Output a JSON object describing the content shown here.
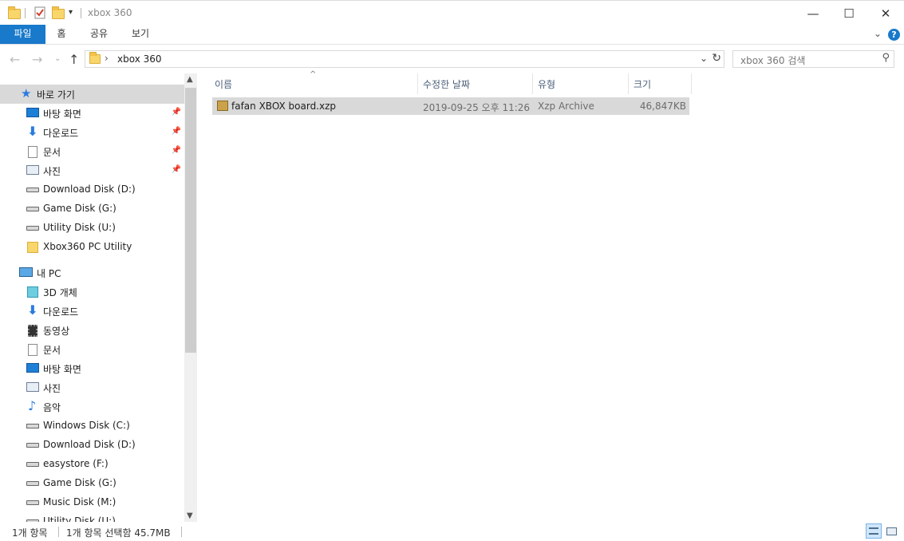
{
  "window": {
    "title": "xbox 360",
    "minimize": "—",
    "maximize": "☐",
    "close": "✕"
  },
  "ribbon": {
    "tabs": [
      "파일",
      "홈",
      "공유",
      "보기"
    ],
    "collapse_icon": "chevron-down-icon",
    "help": "?"
  },
  "address": {
    "path": "xbox 360",
    "separator": "›"
  },
  "search": {
    "placeholder": "xbox 360 검색"
  },
  "sidebar": {
    "quick_access": "바로 가기",
    "quick_items": [
      {
        "label": "바탕 화면",
        "icon": "desktop-icon",
        "pinned": true
      },
      {
        "label": "다운로드",
        "icon": "download-icon",
        "pinned": true
      },
      {
        "label": "문서",
        "icon": "document-icon",
        "pinned": true
      },
      {
        "label": "사진",
        "icon": "picture-icon",
        "pinned": true
      },
      {
        "label": "Download Disk (D:)",
        "icon": "drive-icon"
      },
      {
        "label": "Game Disk (G:)",
        "icon": "drive-icon"
      },
      {
        "label": "Utility Disk (U:)",
        "icon": "drive-icon"
      },
      {
        "label": "Xbox360 PC Utility",
        "icon": "folder-icon"
      }
    ],
    "this_pc": "내 PC",
    "pc_items": [
      {
        "label": "3D 개체",
        "icon": "3d-objects-icon"
      },
      {
        "label": "다운로드",
        "icon": "download-icon"
      },
      {
        "label": "동영상",
        "icon": "video-icon"
      },
      {
        "label": "문서",
        "icon": "document-icon"
      },
      {
        "label": "바탕 화면",
        "icon": "desktop-icon"
      },
      {
        "label": "사진",
        "icon": "picture-icon"
      },
      {
        "label": "음악",
        "icon": "music-icon"
      },
      {
        "label": "Windows Disk (C:)",
        "icon": "windows-drive-icon"
      },
      {
        "label": "Download Disk (D:)",
        "icon": "drive-icon"
      },
      {
        "label": "easystore (F:)",
        "icon": "drive-icon"
      },
      {
        "label": "Game Disk (G:)",
        "icon": "drive-icon"
      },
      {
        "label": "Music Disk (M:)",
        "icon": "drive-icon"
      },
      {
        "label": "Utility Disk (U:)",
        "icon": "drive-icon"
      }
    ]
  },
  "columns": {
    "name": "이름",
    "modified": "수정한 날짜",
    "type": "유형",
    "size": "크기"
  },
  "files": [
    {
      "name": "fafan XBOX board.xzp",
      "modified": "2019-09-25 오후 11:26",
      "type": "Xzp Archive",
      "size": "46,847KB"
    }
  ],
  "status": {
    "count": "1개 항목",
    "selected": "1개 항목 선택함 45.7MB"
  },
  "colors": {
    "accent": "#1979ca",
    "selection": "#d9d9d9",
    "header_text": "#4c607a"
  }
}
